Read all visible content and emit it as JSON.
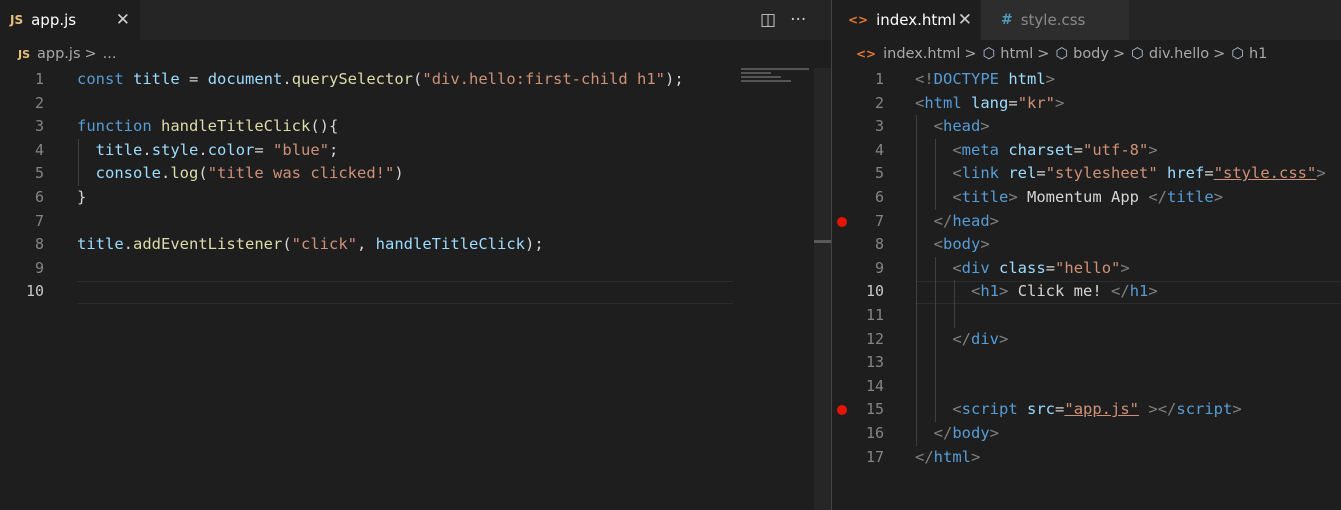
{
  "left_editor": {
    "tab": {
      "label": "app.js",
      "icon_text": "JS",
      "icon": "javascript-file-icon",
      "close_icon": "close-icon"
    },
    "actions": {
      "split_icon": "split-editor-icon",
      "more_icon": "more-actions-icon",
      "split_glyph": "◫",
      "more_glyph": "···"
    },
    "breadcrumb": {
      "icon_text": "JS",
      "file": "app.js",
      "sep": ">",
      "rest": "..."
    },
    "line_numbers": [
      "1",
      "2",
      "3",
      "4",
      "5",
      "6",
      "7",
      "8",
      "9",
      "10"
    ],
    "current_line": 10,
    "lines": [
      [
        [
          "k",
          "const"
        ],
        [
          "p",
          " "
        ],
        [
          "v",
          "title"
        ],
        [
          "p",
          " = "
        ],
        [
          "v",
          "document"
        ],
        [
          "p",
          "."
        ],
        [
          "f",
          "querySelector"
        ],
        [
          "p",
          "("
        ],
        [
          "s",
          "\"div.hello:first-child h1\""
        ],
        [
          "p",
          ");"
        ]
      ],
      [],
      [
        [
          "k",
          "function"
        ],
        [
          "p",
          " "
        ],
        [
          "f",
          "handleTitleClick"
        ],
        [
          "p",
          "(){"
        ]
      ],
      [
        [
          "p",
          "  "
        ],
        [
          "v",
          "title"
        ],
        [
          "p",
          "."
        ],
        [
          "v",
          "style"
        ],
        [
          "p",
          "."
        ],
        [
          "v",
          "color"
        ],
        [
          "p",
          "= "
        ],
        [
          "s",
          "\"blue\""
        ],
        [
          "p",
          ";"
        ]
      ],
      [
        [
          "p",
          "  "
        ],
        [
          "v",
          "console"
        ],
        [
          "p",
          "."
        ],
        [
          "f",
          "log"
        ],
        [
          "p",
          "("
        ],
        [
          "s",
          "\"title was clicked!\""
        ],
        [
          "p",
          ")"
        ]
      ],
      [
        [
          "p",
          "}"
        ]
      ],
      [],
      [
        [
          "v",
          "title"
        ],
        [
          "p",
          "."
        ],
        [
          "f",
          "addEventListener"
        ],
        [
          "p",
          "("
        ],
        [
          "s",
          "\"click\""
        ],
        [
          "p",
          ", "
        ],
        [
          "v",
          "handleTitleClick"
        ],
        [
          "p",
          ");"
        ]
      ],
      [],
      []
    ]
  },
  "right_editor": {
    "tabs": [
      {
        "label": "index.html",
        "icon_text": "<>",
        "icon": "html-file-icon",
        "close_icon": "close-icon",
        "active": true
      },
      {
        "label": "style.css",
        "icon_text": "#",
        "icon": "css-file-icon",
        "active": false
      }
    ],
    "breadcrumb": [
      {
        "label": "index.html",
        "icon_text": "<>",
        "icon": "html-file-icon"
      },
      {
        "label": "html",
        "icon": "element-cube-icon"
      },
      {
        "label": "body",
        "icon": "element-cube-icon"
      },
      {
        "label": "div.hello",
        "icon": "element-cube-icon"
      },
      {
        "label": "h1",
        "icon": "element-cube-icon"
      }
    ],
    "breadcrumb_sep": ">",
    "cube_glyph": "⬡",
    "line_numbers": [
      "1",
      "2",
      "3",
      "4",
      "5",
      "6",
      "7",
      "8",
      "9",
      "10",
      "11",
      "12",
      "13",
      "14",
      "15",
      "16",
      "17"
    ],
    "current_line": 10,
    "breakpoints": [
      7,
      15
    ],
    "lines": [
      [
        [
          "t",
          "<!"
        ],
        [
          "tn",
          "DOCTYPE"
        ],
        [
          "p",
          " "
        ],
        [
          "a",
          "html"
        ],
        [
          "t",
          ">"
        ]
      ],
      [
        [
          "t",
          "<"
        ],
        [
          "tn",
          "html"
        ],
        [
          "p",
          " "
        ],
        [
          "a",
          "lang"
        ],
        [
          "p",
          "="
        ],
        [
          "s",
          "\"kr\""
        ],
        [
          "t",
          ">"
        ]
      ],
      [
        [
          "p",
          "  "
        ],
        [
          "t",
          "<"
        ],
        [
          "tn",
          "head"
        ],
        [
          "t",
          ">"
        ]
      ],
      [
        [
          "p",
          "    "
        ],
        [
          "t",
          "<"
        ],
        [
          "tn",
          "meta"
        ],
        [
          "p",
          " "
        ],
        [
          "a",
          "charset"
        ],
        [
          "p",
          "="
        ],
        [
          "s",
          "\"utf-8\""
        ],
        [
          "t",
          ">"
        ]
      ],
      [
        [
          "p",
          "    "
        ],
        [
          "t",
          "<"
        ],
        [
          "tn",
          "link"
        ],
        [
          "p",
          " "
        ],
        [
          "a",
          "rel"
        ],
        [
          "p",
          "="
        ],
        [
          "s",
          "\"stylesheet\""
        ],
        [
          "p",
          " "
        ],
        [
          "a",
          "href"
        ],
        [
          "p",
          "="
        ],
        [
          "su",
          "\"style.css\""
        ],
        [
          "t",
          ">"
        ]
      ],
      [
        [
          "p",
          "    "
        ],
        [
          "t",
          "<"
        ],
        [
          "tn",
          "title"
        ],
        [
          "t",
          ">"
        ],
        [
          "p",
          " Momentum App "
        ],
        [
          "t",
          "</"
        ],
        [
          "tn",
          "title"
        ],
        [
          "t",
          ">"
        ]
      ],
      [
        [
          "p",
          "  "
        ],
        [
          "t",
          "</"
        ],
        [
          "tn",
          "head"
        ],
        [
          "t",
          ">"
        ]
      ],
      [
        [
          "p",
          "  "
        ],
        [
          "t",
          "<"
        ],
        [
          "tn",
          "body"
        ],
        [
          "t",
          ">"
        ]
      ],
      [
        [
          "p",
          "    "
        ],
        [
          "t",
          "<"
        ],
        [
          "tn",
          "div"
        ],
        [
          "p",
          " "
        ],
        [
          "a",
          "class"
        ],
        [
          "p",
          "="
        ],
        [
          "s",
          "\"hello\""
        ],
        [
          "t",
          ">"
        ]
      ],
      [
        [
          "p",
          "      "
        ],
        [
          "t",
          "<"
        ],
        [
          "tn",
          "h1"
        ],
        [
          "t",
          ">"
        ],
        [
          "p",
          " Click me! "
        ],
        [
          "t",
          "</"
        ],
        [
          "tn",
          "h1"
        ],
        [
          "t",
          ">"
        ]
      ],
      [],
      [
        [
          "p",
          "    "
        ],
        [
          "t",
          "</"
        ],
        [
          "tn",
          "div"
        ],
        [
          "t",
          ">"
        ]
      ],
      [],
      [],
      [
        [
          "p",
          "    "
        ],
        [
          "t",
          "<"
        ],
        [
          "tn",
          "script"
        ],
        [
          "p",
          " "
        ],
        [
          "a",
          "src"
        ],
        [
          "p",
          "="
        ],
        [
          "su",
          "\"app.js\""
        ],
        [
          "p",
          " "
        ],
        [
          "t",
          "></"
        ],
        [
          "tn",
          "script"
        ],
        [
          "t",
          ">"
        ]
      ],
      [
        [
          "p",
          "  "
        ],
        [
          "t",
          "</"
        ],
        [
          "tn",
          "body"
        ],
        [
          "t",
          ">"
        ]
      ],
      [
        [
          "t",
          "</"
        ],
        [
          "tn",
          "html"
        ],
        [
          "t",
          ">"
        ]
      ]
    ]
  },
  "colors": {
    "keyword": "#569cd6",
    "variable": "#9cdcfe",
    "function": "#dcdcaa",
    "string": "#ce9178",
    "tag_bracket": "#808080",
    "breakpoint": "#e51400",
    "js_icon": "#e5c07b",
    "html_icon": "#e37933",
    "css_icon": "#519aba"
  }
}
